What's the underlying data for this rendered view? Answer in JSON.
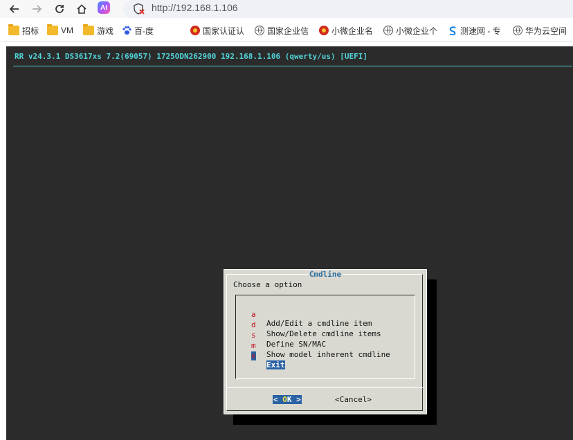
{
  "browser": {
    "url": "http://192.168.1.106",
    "ai_badge": "AI"
  },
  "bookmarks": [
    {
      "label": "招标",
      "icon": "folder-icon"
    },
    {
      "label": "VM",
      "icon": "folder-icon"
    },
    {
      "label": "游戏",
      "icon": "folder-icon"
    },
    {
      "label": "百-度",
      "icon": "baidu-paw-icon"
    },
    {
      "label": "国家认证认",
      "icon": "national-emblem-icon"
    },
    {
      "label": "国家企业信",
      "icon": "globe-icon"
    },
    {
      "label": "小微企业名",
      "icon": "national-emblem-icon"
    },
    {
      "label": "小微企业个",
      "icon": "globe-icon"
    },
    {
      "label": "测速网 - 专",
      "icon": "speedtest-icon"
    },
    {
      "label": "华为云空间",
      "icon": "globe-icon"
    }
  ],
  "terminal": {
    "status_line": "RR v24.3.1 DS3617xs 7.2(69057) 1725ODN262900 192.168.1.106 (qwerty/us) [UEFI]",
    "colors": {
      "background": "#2b2b2b",
      "status": "#52d3d9",
      "dialog": "#d9d9d2",
      "selection": "#2a62a3",
      "hotkey": "#c0101a"
    }
  },
  "dialog": {
    "title": "Cmdline",
    "prompt": "Choose a option",
    "items": [
      {
        "key": "a",
        "label": "Add/Edit a cmdline item"
      },
      {
        "key": "d",
        "label": "Show/Delete cmdline items"
      },
      {
        "key": "s",
        "label": "Define SN/MAC"
      },
      {
        "key": "m",
        "label": "Show model inherent cmdline"
      },
      {
        "key": "e",
        "label": "Exit",
        "selected": true
      }
    ],
    "ok_left": "< ",
    "ok_hot": "O",
    "ok_rest": "K >",
    "cancel": "<Cancel>"
  }
}
